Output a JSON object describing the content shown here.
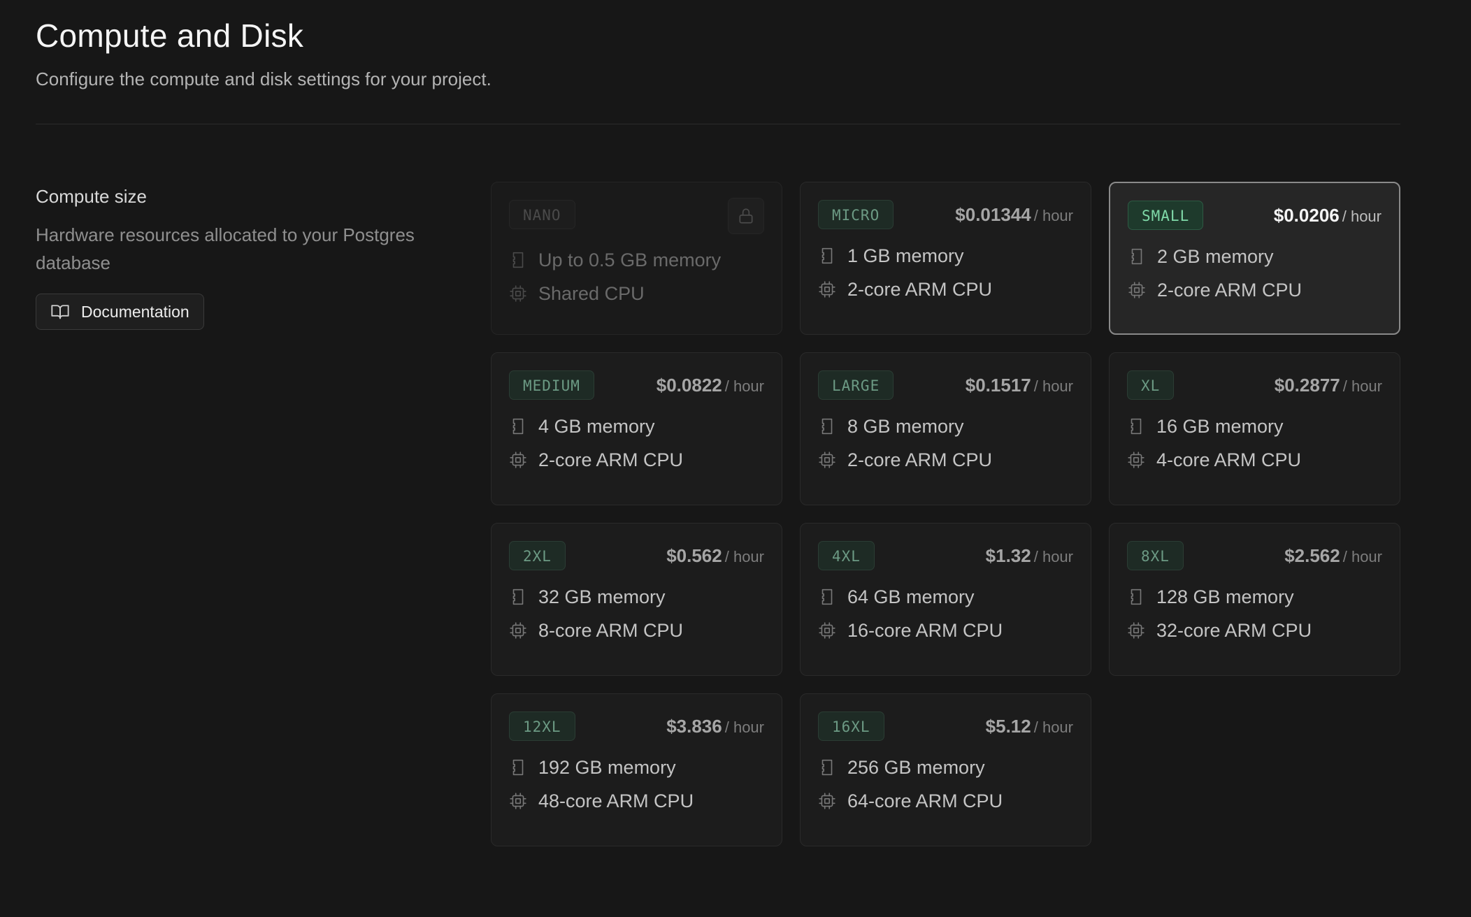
{
  "header": {
    "title": "Compute and Disk",
    "subtitle": "Configure the compute and disk settings for your project."
  },
  "section": {
    "title": "Compute size",
    "description": "Hardware resources allocated to your Postgres database",
    "doc_button_label": "Documentation"
  },
  "colors": {
    "background": "#171717",
    "badge_text": "#6c9a84",
    "selected_badge_text": "#7fd9a8",
    "selected_border": "#8a8a8a"
  },
  "compute": {
    "unit": "/ hour",
    "selected": "SMALL",
    "options": [
      {
        "name": "NANO",
        "price": "",
        "memory": "Up to 0.5 GB memory",
        "cpu": "Shared CPU",
        "state": "locked"
      },
      {
        "name": "MICRO",
        "price": "$0.01344",
        "memory": "1 GB memory",
        "cpu": "2-core ARM CPU",
        "state": "available"
      },
      {
        "name": "SMALL",
        "price": "$0.0206",
        "memory": "2 GB memory",
        "cpu": "2-core ARM CPU",
        "state": "selected"
      },
      {
        "name": "MEDIUM",
        "price": "$0.0822",
        "memory": "4 GB memory",
        "cpu": "2-core ARM CPU",
        "state": "available"
      },
      {
        "name": "LARGE",
        "price": "$0.1517",
        "memory": "8 GB memory",
        "cpu": "2-core ARM CPU",
        "state": "available"
      },
      {
        "name": "XL",
        "price": "$0.2877",
        "memory": "16 GB memory",
        "cpu": "4-core ARM CPU",
        "state": "available"
      },
      {
        "name": "2XL",
        "price": "$0.562",
        "memory": "32 GB memory",
        "cpu": "8-core ARM CPU",
        "state": "available"
      },
      {
        "name": "4XL",
        "price": "$1.32",
        "memory": "64 GB memory",
        "cpu": "16-core ARM CPU",
        "state": "available"
      },
      {
        "name": "8XL",
        "price": "$2.562",
        "memory": "128 GB memory",
        "cpu": "32-core ARM CPU",
        "state": "available"
      },
      {
        "name": "12XL",
        "price": "$3.836",
        "memory": "192 GB memory",
        "cpu": "48-core ARM CPU",
        "state": "available"
      },
      {
        "name": "16XL",
        "price": "$5.12",
        "memory": "256 GB memory",
        "cpu": "64-core ARM CPU",
        "state": "available"
      }
    ]
  },
  "icons": {
    "doc_button": "book-open-icon",
    "locked": "lock-icon",
    "memory": "memory-stick-icon",
    "cpu": "cpu-chip-icon"
  }
}
